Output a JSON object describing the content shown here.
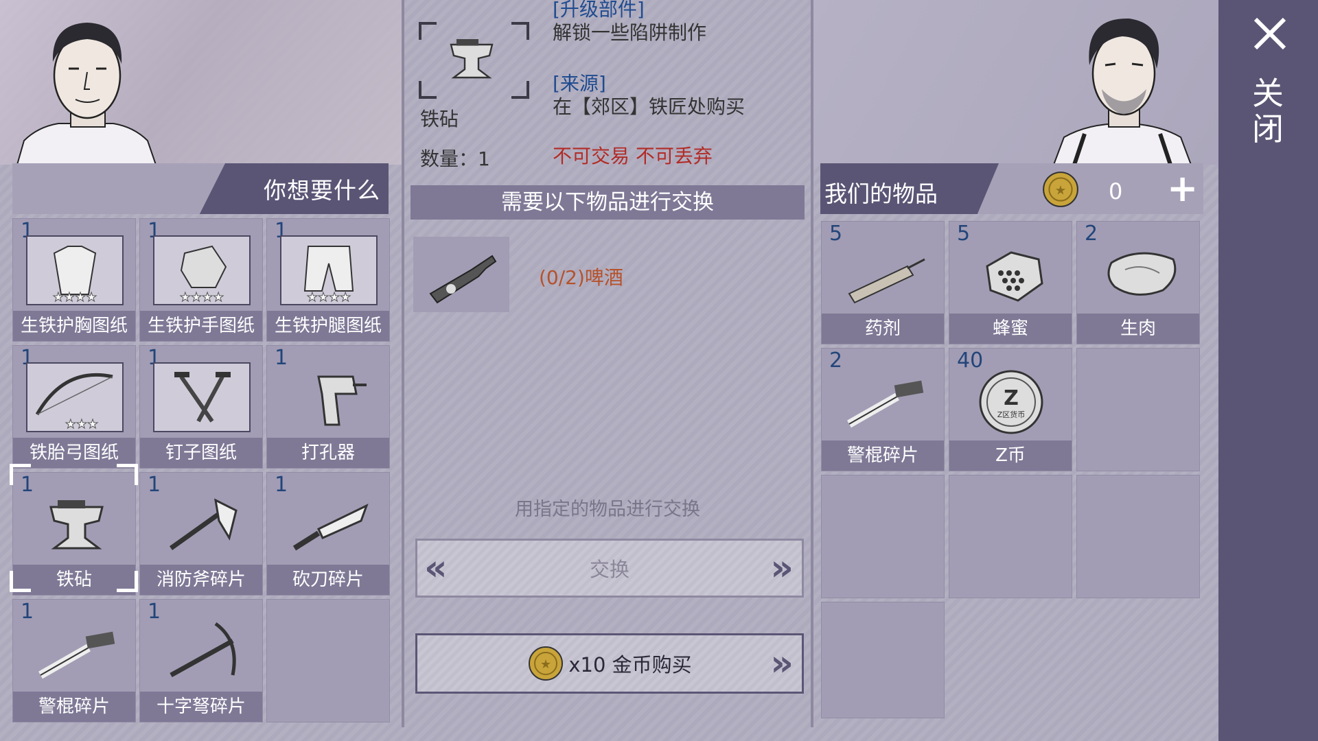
{
  "left": {
    "header": "你想要什么",
    "items": [
      {
        "qty": "1",
        "label": "生铁护胸图纸",
        "icon": "chestplate-blueprint-icon"
      },
      {
        "qty": "1",
        "label": "生铁护手图纸",
        "icon": "gauntlet-blueprint-icon"
      },
      {
        "qty": "1",
        "label": "生铁护腿图纸",
        "icon": "leg-armor-blueprint-icon"
      },
      {
        "qty": "1",
        "label": "铁胎弓图纸",
        "icon": "bow-blueprint-icon"
      },
      {
        "qty": "1",
        "label": "钉子图纸",
        "icon": "nails-blueprint-icon"
      },
      {
        "qty": "1",
        "label": "打孔器",
        "icon": "drill-icon"
      },
      {
        "qty": "1",
        "label": "铁砧",
        "icon": "anvil-icon"
      },
      {
        "qty": "1",
        "label": "消防斧碎片",
        "icon": "fire-axe-icon"
      },
      {
        "qty": "1",
        "label": "砍刀碎片",
        "icon": "machete-icon"
      },
      {
        "qty": "1",
        "label": "警棍碎片",
        "icon": "baton-icon"
      },
      {
        "qty": "1",
        "label": "十字弩碎片",
        "icon": "crossbow-icon"
      }
    ]
  },
  "detail": {
    "category": "[升级部件]",
    "description": "解锁一些陷阱制作",
    "source_title": "[来源]",
    "source_text": "在【郊区】铁匠处购买",
    "name": "铁砧",
    "count": "数量：1",
    "restriction": "不可交易 不可丢弃",
    "need_header": "需要以下物品进行交换",
    "required_item": "(0/2)啤酒",
    "exchange_hint": "用指定的物品进行交换",
    "exchange_label": "交换",
    "buy_label": "x10 金币购买"
  },
  "right": {
    "header": "我们的物品",
    "coins": "0",
    "items": [
      {
        "qty": "5",
        "label": "药剂",
        "icon": "syringe-icon"
      },
      {
        "qty": "5",
        "label": "蜂蜜",
        "icon": "honeycomb-icon"
      },
      {
        "qty": "2",
        "label": "生肉",
        "icon": "raw-meat-icon"
      },
      {
        "qty": "2",
        "label": "警棍碎片",
        "icon": "baton-icon"
      },
      {
        "qty": "40",
        "label": "Z币",
        "icon": "z-coin-icon",
        "coin_text": "Z区货币"
      }
    ]
  },
  "close_label": "关闭",
  "colors": {
    "tab_dark": "#5b5575",
    "slot_bg": "#a29db4",
    "label_bg": "#7f7996",
    "qty_blue": "#23457a",
    "warning_red": "#b22b26",
    "link_blue": "#1f4b8f"
  }
}
